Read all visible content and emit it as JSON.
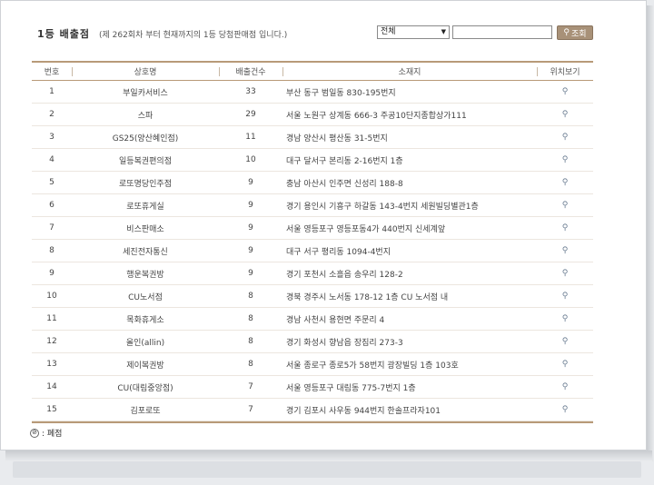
{
  "header": {
    "title": "1등 배출점",
    "subtitle": "(제 262회차 부터 현재까지의 1등 당첨판매점 입니다.)"
  },
  "search": {
    "region_selected": "전체",
    "input_value": "",
    "button_label": "조회"
  },
  "table": {
    "columns": [
      "번호",
      "상호명",
      "배출건수",
      "소재지",
      "위치보기"
    ],
    "rows": [
      {
        "no": "1",
        "name": "부일카서비스",
        "count": "33",
        "address": "부산 동구 범일동 830-195번지"
      },
      {
        "no": "2",
        "name": "스파",
        "count": "29",
        "address": "서울 노원구 상계동 666-3 주공10단지종합상가111"
      },
      {
        "no": "3",
        "name": "GS25(양산혜인점)",
        "count": "11",
        "address": "경남 양산시 평산동 31-5번지"
      },
      {
        "no": "4",
        "name": "일등복권편의점",
        "count": "10",
        "address": "대구 달서구 본리동 2-16번지 1층"
      },
      {
        "no": "5",
        "name": "로또명당인주점",
        "count": "9",
        "address": "충남 아산시 인주면 신성리 188-8"
      },
      {
        "no": "6",
        "name": "로또휴게실",
        "count": "9",
        "address": "경기 용인시 기흥구 하갈동 143-4번지 세원빌딩별관1층"
      },
      {
        "no": "7",
        "name": "비스판매소",
        "count": "9",
        "address": "서울 영등포구 영등포동4가 440번지 신세계앞"
      },
      {
        "no": "8",
        "name": "세진전자통신",
        "count": "9",
        "address": "대구 서구 평리동 1094-4번지"
      },
      {
        "no": "9",
        "name": "행운복권방",
        "count": "9",
        "address": "경기 포천시 소흘읍 송우리 128-2"
      },
      {
        "no": "10",
        "name": "CU노서점",
        "count": "8",
        "address": "경북 경주시 노서동 178-12 1층 CU 노서점 내"
      },
      {
        "no": "11",
        "name": "목화휴게소",
        "count": "8",
        "address": "경남 사천시 용현면 주문리 4"
      },
      {
        "no": "12",
        "name": "올인(allin)",
        "count": "8",
        "address": "경기 화성시 향남읍 장짐리 273-3"
      },
      {
        "no": "13",
        "name": "제이복권방",
        "count": "8",
        "address": "서울 종로구 종로5가 58번지 광장빌딩 1층 103호"
      },
      {
        "no": "14",
        "name": "CU(대림중앙점)",
        "count": "7",
        "address": "서울 영등포구 대림동 775-7번지 1층"
      },
      {
        "no": "15",
        "name": "김포로또",
        "count": "7",
        "address": "경기 김포시 사우동 944번지 한솔프라자101"
      }
    ]
  },
  "legend": {
    "label": ": 폐점"
  },
  "colors": {
    "accent": "#b89a78",
    "button": "#a89178"
  }
}
